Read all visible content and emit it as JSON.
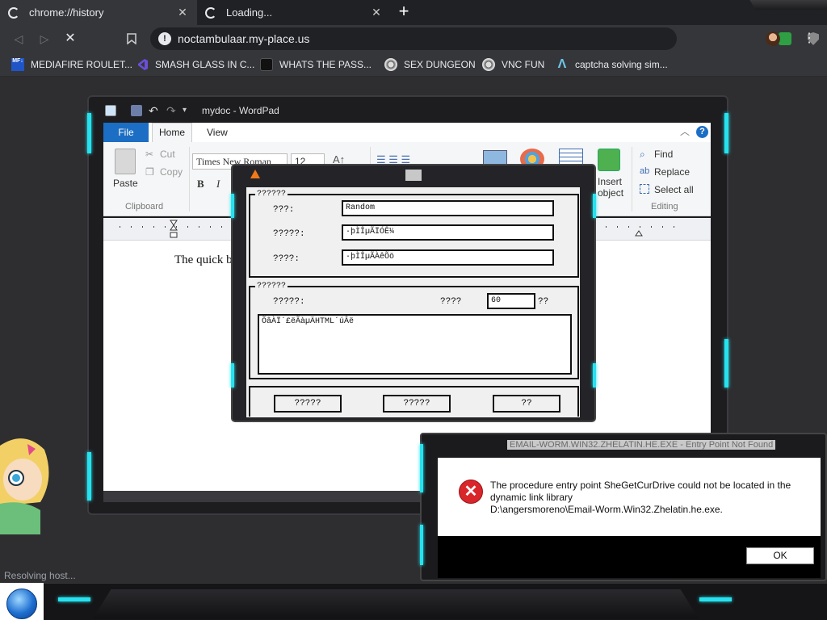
{
  "browser": {
    "tabs": [
      {
        "title": "chrome://history"
      },
      {
        "title": "Loading..."
      }
    ],
    "new_tab": "+",
    "url": "noctambulaar.my-place.us",
    "info_glyph": "!",
    "menu_glyph": "⋮",
    "bookmarks": [
      {
        "label": "MEDIAFIRE ROULET...",
        "icon": "mediafire-icon",
        "color": "#2055c8"
      },
      {
        "label": "SMASH GLASS IN C...",
        "icon": "visualstudio-icon",
        "color": "#5b3fc0"
      },
      {
        "label": "WHATS THE PASS...",
        "icon": "lock-icon",
        "color": "#222222"
      },
      {
        "label": "SEX DUNGEON",
        "icon": "steam-icon",
        "color": "#dddddd"
      },
      {
        "label": "VNC FUN",
        "icon": "steam-icon",
        "color": "#dddddd"
      },
      {
        "label": "captcha solving sim...",
        "icon": "lambda-icon",
        "color": "#6ec6e8"
      }
    ],
    "status": "Resolving host..."
  },
  "wordpad": {
    "title": "mydoc - WordPad",
    "tabs": {
      "file": "File",
      "home": "Home",
      "view": "View"
    },
    "help": "?",
    "clipboard": {
      "paste": "Paste",
      "cut": "Cut",
      "copy": "Copy",
      "group": "Clipboard"
    },
    "font": {
      "name": "Times New Roman",
      "size": "12"
    },
    "format": {
      "bold": "B",
      "italic": "I"
    },
    "insert": {
      "label_1": "Insert",
      "label_2": "object"
    },
    "editing": {
      "find": "Find",
      "replace": "Replace",
      "select_all": "Select all",
      "group": "Editing"
    },
    "doc_text": "The quick br"
  },
  "bogus_dialog": {
    "group1_legend": "??????",
    "fields": [
      {
        "label": "???:",
        "value": "Random"
      },
      {
        "label": "?????:",
        "value": "·þÌÎµÃÏÓÊ¼"
      },
      {
        "label": "????:",
        "value": "·þÌÎµÃÀêÕö"
      }
    ],
    "group2_legend": "??????",
    "row_label": "?????:",
    "count_label": "????",
    "count_value": "60",
    "count_unit": "??",
    "textarea_value": "ÕâÀÏ´£ëÃàµÄHTML´úÂë",
    "buttons": [
      "?????",
      "?????",
      "??"
    ]
  },
  "error_dialog": {
    "title": "EMAIL-WORM.WIN32.ZHELATIN.HE.EXE - Entry Point Not Found",
    "icon_glyph": "✕",
    "message_1": "The procedure entry point SheGetCurDrive could not be located in the",
    "message_2": "dynamic link library",
    "message_3": "D:\\angersmoreno\\Email-Worm.Win32.Zhelatin.he.exe.",
    "ok": "OK"
  },
  "colors": {
    "accent_cyan": "#26e2ee",
    "file_blue": "#1c6ec4",
    "error_red": "#d9262a"
  }
}
